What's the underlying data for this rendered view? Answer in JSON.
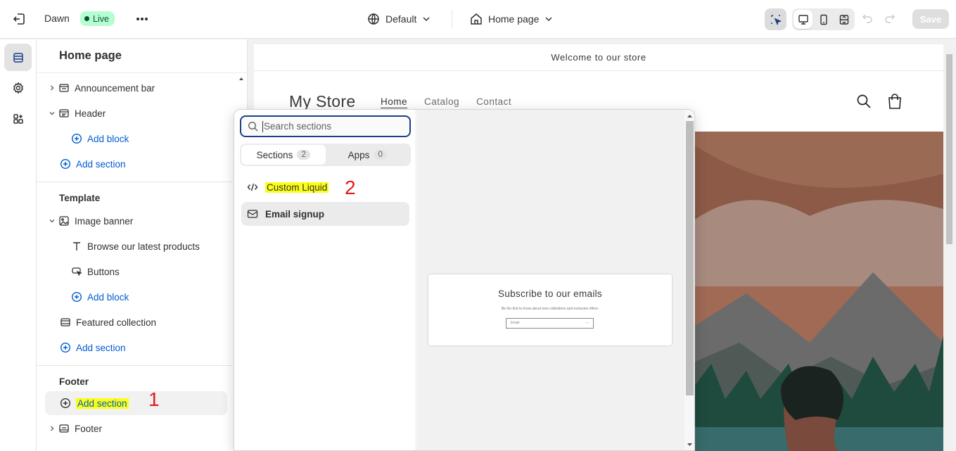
{
  "topbar": {
    "theme_name": "Dawn",
    "status": "Live",
    "theme_setting": "Default",
    "page": "Home page",
    "save": "Save"
  },
  "sidebar": {
    "title": "Home page",
    "header_items": [
      {
        "label": "Announcement bar"
      },
      {
        "label": "Header"
      },
      {
        "label": "Add block"
      },
      {
        "label": "Add section"
      }
    ],
    "template_label": "Template",
    "template_items": [
      {
        "label": "Image banner"
      },
      {
        "label": "Browse our latest products"
      },
      {
        "label": "Buttons"
      },
      {
        "label": "Add block"
      },
      {
        "label": "Featured collection"
      },
      {
        "label": "Add section"
      }
    ],
    "footer_label": "Footer",
    "footer_items": [
      {
        "label": "Add section"
      },
      {
        "label": "Footer"
      }
    ],
    "annotation": "1"
  },
  "preview": {
    "announcement": "Welcome to our store",
    "store_name": "My Store",
    "nav": [
      "Home",
      "Catalog",
      "Contact"
    ]
  },
  "popover": {
    "search_placeholder": "Search sections",
    "tabs": [
      {
        "label": "Sections",
        "count": "2"
      },
      {
        "label": "Apps",
        "count": "0"
      }
    ],
    "items": [
      {
        "label": "Custom Liquid"
      },
      {
        "label": "Email signup"
      }
    ],
    "annotation": "2",
    "preview_card": {
      "title": "Subscribe to our emails",
      "subtitle": "Be the first to know about new collections and exclusive offers.",
      "input_placeholder": "Email"
    }
  },
  "colors": {
    "link": "#005bd3",
    "highlight": "#fbff15",
    "live_badge": "#b4fed2",
    "annotation": "#e31b1b"
  }
}
